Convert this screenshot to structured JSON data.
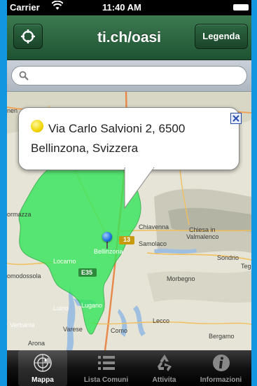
{
  "status_bar": {
    "carrier": "Carrier",
    "time": "11:40 AM"
  },
  "nav": {
    "title": "ti.ch/oasi",
    "legend_button": "Legenda"
  },
  "search": {
    "value": "",
    "placeholder": ""
  },
  "callout": {
    "address_line1": "Via Carlo Salvioni 2, 6500",
    "address_line2": "Bellinzona, Svizzera"
  },
  "map_labels": {
    "chiavenna": "Chiavenna",
    "chiesa": "Chiesa in",
    "valmalenco": "Valmalenco",
    "samolaco": "Samolaco",
    "sondrio": "Sondrio",
    "teg": "Teg",
    "morbegno": "Morbegno",
    "omodossola": "omodossola",
    "locarno": "Locarno",
    "bellinzona": "Bellinzona",
    "lugano": "Lugano",
    "luino": "Luino",
    "verbania": "Verbania",
    "varese": "Varese",
    "como": "Como",
    "lecco": "Lecco",
    "bergamo": "Bergamo",
    "rmazza": "ormazza",
    "nen": "nen",
    "arona": "Arona",
    "road_13": "13",
    "road_e35": "E35"
  },
  "tabs": [
    {
      "label": "Mappa",
      "icon": "radar-icon"
    },
    {
      "label": "Lista Comuni",
      "icon": "list-icon"
    },
    {
      "label": "Attivita",
      "icon": "recycle-icon"
    },
    {
      "label": "Informazioni",
      "icon": "info-icon"
    }
  ],
  "colors": {
    "nav_green": "#2d6642",
    "region_green": "#33e65a",
    "pin_blue": "#1e6ee0",
    "background_blue": "#1296e0"
  }
}
